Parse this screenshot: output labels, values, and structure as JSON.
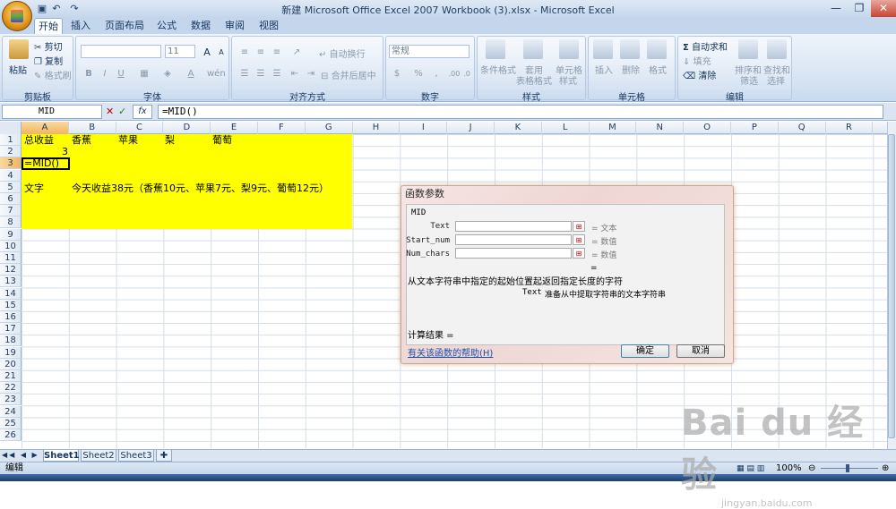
{
  "window": {
    "title": "新建 Microsoft Office Excel 2007 Workbook (3).xlsx - Microsoft Excel",
    "minimize_glyph": "—",
    "restore_glyph": "❐",
    "close_glyph": "✕"
  },
  "quick_access": [
    "save-icon",
    "undo-icon",
    "redo-icon"
  ],
  "tabs": [
    {
      "label": "开始",
      "active": true
    },
    {
      "label": "插入"
    },
    {
      "label": "页面布局"
    },
    {
      "label": "公式"
    },
    {
      "label": "数据"
    },
    {
      "label": "审阅"
    },
    {
      "label": "视图"
    }
  ],
  "ribbon": {
    "clipboard": {
      "label": "剪贴板",
      "paste": "粘贴",
      "cut": "剪切",
      "copy": "复制",
      "format_painter": "格式刷"
    },
    "font": {
      "label": "字体",
      "size": "11",
      "bold": "B",
      "italic": "I",
      "underline": "U",
      "grow": "A",
      "shrink": "A",
      "wen": "wén"
    },
    "alignment": {
      "label": "对齐方式",
      "wrap": "自动换行",
      "merge": "合并后居中"
    },
    "number": {
      "label": "数字",
      "format": "常规",
      "percent": "%",
      "comma": ","
    },
    "styles": {
      "label": "样式",
      "conditional": "条件格式",
      "table_line1": "套用",
      "table_line2": "表格格式",
      "cell_line1": "单元格",
      "cell_line2": "样式"
    },
    "cells": {
      "label": "单元格",
      "insert": "插入",
      "delete": "删除",
      "format": "格式"
    },
    "editing": {
      "label": "编辑",
      "autosum": "自动求和",
      "fill": "填充",
      "clear": "清除",
      "sort_line1": "排序和",
      "sort_line2": "筛选",
      "find_line1": "查找和",
      "find_line2": "选择"
    }
  },
  "formula_bar": {
    "name_box": "MID",
    "fx": "fx",
    "formula": "=MID()",
    "cancel_glyph": "✕",
    "enter_glyph": "✓"
  },
  "columns": [
    "A",
    "B",
    "C",
    "D",
    "E",
    "F",
    "G",
    "H",
    "I",
    "J",
    "K",
    "L",
    "M",
    "N",
    "O",
    "P",
    "Q",
    "R"
  ],
  "rows": [
    "1",
    "2",
    "3",
    "4",
    "5",
    "6",
    "7",
    "8",
    "9",
    "10",
    "11",
    "12",
    "13",
    "14",
    "15",
    "16",
    "17",
    "18",
    "19",
    "20",
    "21",
    "22",
    "23",
    "24",
    "25",
    "26"
  ],
  "cells": {
    "A1": "总收益",
    "B1": "香蕉",
    "C1": "苹果",
    "D1": "梨",
    "E1": "葡萄",
    "B2": "3",
    "A3": "=MID()",
    "A5": "文字",
    "B5": "今天收益38元（香蕉10元、苹果7元、梨9元、葡萄12元）"
  },
  "dialog": {
    "title": "函数参数",
    "function": "MID",
    "args": [
      {
        "name": "Text",
        "result": "=  文本"
      },
      {
        "name": "Start_num",
        "result": "=  数值"
      },
      {
        "name": "Num_chars",
        "result": "=  数值"
      }
    ],
    "equals": "=",
    "description": "从文本字符串中指定的起始位置起返回指定长度的字符",
    "arg_help_name": "Text",
    "arg_help": "准备从中提取字符串的文本字符串",
    "result_label": "计算结果 =",
    "help_link": "有关该函数的帮助(H)",
    "ok": "确定",
    "cancel": "取消",
    "pick_glyph": "⊞"
  },
  "sheets": [
    {
      "label": "Sheet1",
      "active": true
    },
    {
      "label": "Sheet2"
    },
    {
      "label": "Sheet3"
    }
  ],
  "status": {
    "mode": "编辑",
    "zoom": "100%"
  },
  "watermark": {
    "logo": "Bai du 经验",
    "url": "jingyan.baidu.com"
  }
}
